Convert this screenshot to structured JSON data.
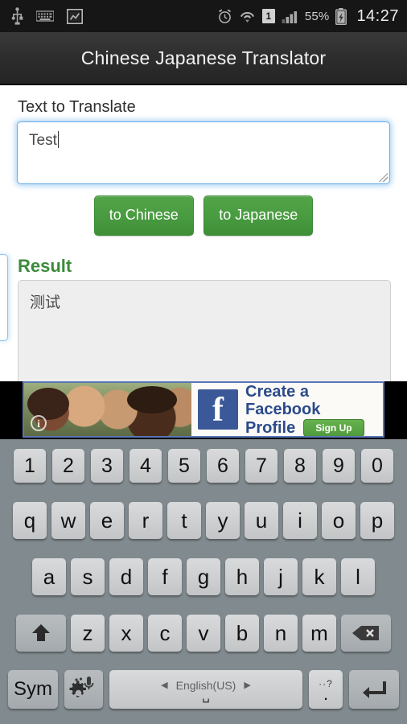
{
  "status_bar": {
    "left_icons": [
      "usb-icon",
      "keyboard-icon",
      "screenshot-icon"
    ],
    "alarm_icon": "alarm-icon",
    "wifi_icon": "wifi-icon",
    "sim_label": "1",
    "signal_icon": "signal-bars-icon",
    "battery_percent": "55%",
    "battery_icon": "battery-charging-icon",
    "clock": "14:27"
  },
  "app": {
    "title": "Chinese Japanese Translator"
  },
  "form": {
    "input_label": "Text to Translate",
    "input_value": "Test",
    "input_placeholder": "",
    "buttons": [
      {
        "label": "to Chinese",
        "name": "to-chinese-button"
      },
      {
        "label": "to Japanese",
        "name": "to-japanese-button"
      }
    ],
    "result_label": "Result",
    "result_value": "测试"
  },
  "ad": {
    "line1": "Create a Facebook",
    "line2": "Profile",
    "cta": "Sign Up",
    "brand_glyph": "f",
    "info_glyph": "i"
  },
  "keyboard": {
    "row_numbers": [
      "1",
      "2",
      "3",
      "4",
      "5",
      "6",
      "7",
      "8",
      "9",
      "0"
    ],
    "row_q": [
      "q",
      "w",
      "e",
      "r",
      "t",
      "y",
      "u",
      "i",
      "o",
      "p"
    ],
    "row_a": [
      "a",
      "s",
      "d",
      "f",
      "g",
      "h",
      "j",
      "k",
      "l"
    ],
    "row_z": [
      "z",
      "x",
      "c",
      "v",
      "b",
      "n",
      "m"
    ],
    "shift_label": "⬆",
    "backspace_label": "⌫",
    "sym_label": "Sym",
    "settings_icon": "gear-mic-icon",
    "space_language": "English(US)",
    "space_prev_arrow": "◀",
    "space_next_arrow": "▶",
    "space_glyph": "␣",
    "period_top": "··?",
    "period_label": ".",
    "enter_label": "↵"
  },
  "colors": {
    "accent_green": "#4a9c41",
    "result_green": "#3c8a3c",
    "focus_blue": "#66afe9",
    "keyboard_bg": "#808a8f",
    "facebook_blue": "#3b5998"
  }
}
